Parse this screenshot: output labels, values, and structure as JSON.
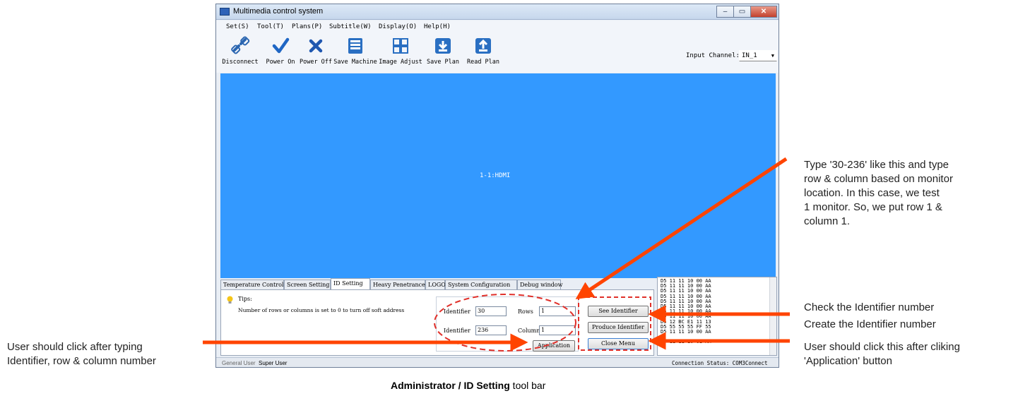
{
  "window": {
    "title": "Multimedia control system",
    "minimize": "–",
    "maximize": "▭",
    "close": "✕"
  },
  "menu": [
    "Set(S)",
    "Tool(T)",
    "Plans(P)",
    "Subtitle(W)",
    "Display(O)",
    "Help(H)"
  ],
  "toolbar": {
    "buttons": [
      {
        "label": "Disconnect",
        "icon": "disconnect-icon"
      },
      {
        "label": "Power On",
        "icon": "checkmark-icon"
      },
      {
        "label": "Power Off",
        "icon": "x-icon"
      },
      {
        "label": "Save Machine",
        "icon": "save-machine-icon"
      },
      {
        "label": "Image Adjust",
        "icon": "image-adjust-icon"
      },
      {
        "label": "Save Plan",
        "icon": "save-plan-icon"
      },
      {
        "label": "Read Plan",
        "icon": "read-plan-icon"
      }
    ],
    "input_channel_label": "Input Channel:",
    "input_channel_value": "IN_1"
  },
  "display": {
    "label": "1-1:HDMI",
    "color": "#3399ff"
  },
  "tabs": [
    "Temperature Control",
    "Screen Setting",
    "ID Setting",
    "Heavy Penetrance",
    "LOGO",
    "System Configuration",
    "Debug window"
  ],
  "active_tab": "ID Setting",
  "panel": {
    "tips_label": "Tips:",
    "tips_text": "Number of rows or columns is set to 0 to turn off soft address",
    "identifier_label_1": "Identifier",
    "identifier_value_1": "30",
    "rows_label": "Rows",
    "rows_value": "1",
    "identifier_label_2": "Identifier",
    "identifier_value_2": "236",
    "columns_label": "Columns",
    "columns_value": "1",
    "application_button": "Application",
    "see_identifier_button": "See Identifier",
    "produce_identifier_button": "Produce Identifier",
    "close_menu_button": "Close Menu"
  },
  "log_lines": [
    "D5 11 11 10 00 AA",
    "D5 11 11 10 00 AA",
    "D5 11 11 10 00 AA",
    "D5 11 11 10 00 AA",
    "D5 11 11 10 00 AA",
    "D5 11 11 10 00 AA",
    "D5 11 11 10 00 AA",
    "D5 11 11 10 00 AA",
    "D5 12 BC E1 11 13",
    "D5 55 55 55 FF 55",
    "D5 11 11 10 00 AA",
    "",
    "D5 11 11 10 01 AA"
  ],
  "status": {
    "general_user": "General User",
    "super_user": "Super User",
    "connection": "Connection Status:  COM3Connect"
  },
  "annotations": {
    "top_right": [
      "Type '30-236' like this and type",
      "row & column based on monitor",
      "location. In this case, we test",
      "1 monitor. So, we put row 1 &",
      "column 1."
    ],
    "check_identifier": "Check the Identifier number",
    "create_identifier": "Create the Identifier number",
    "click_after_app": [
      "User should click this after cliking",
      "'Application' button"
    ],
    "left": [
      "User should click after typing",
      "Identifier, row & column number"
    ]
  },
  "caption": {
    "bold": "Administrator / ID Setting",
    "rest": " tool bar"
  },
  "colors": {
    "arrow": "#ff4400",
    "dashed_highlight": "#e0302a"
  }
}
